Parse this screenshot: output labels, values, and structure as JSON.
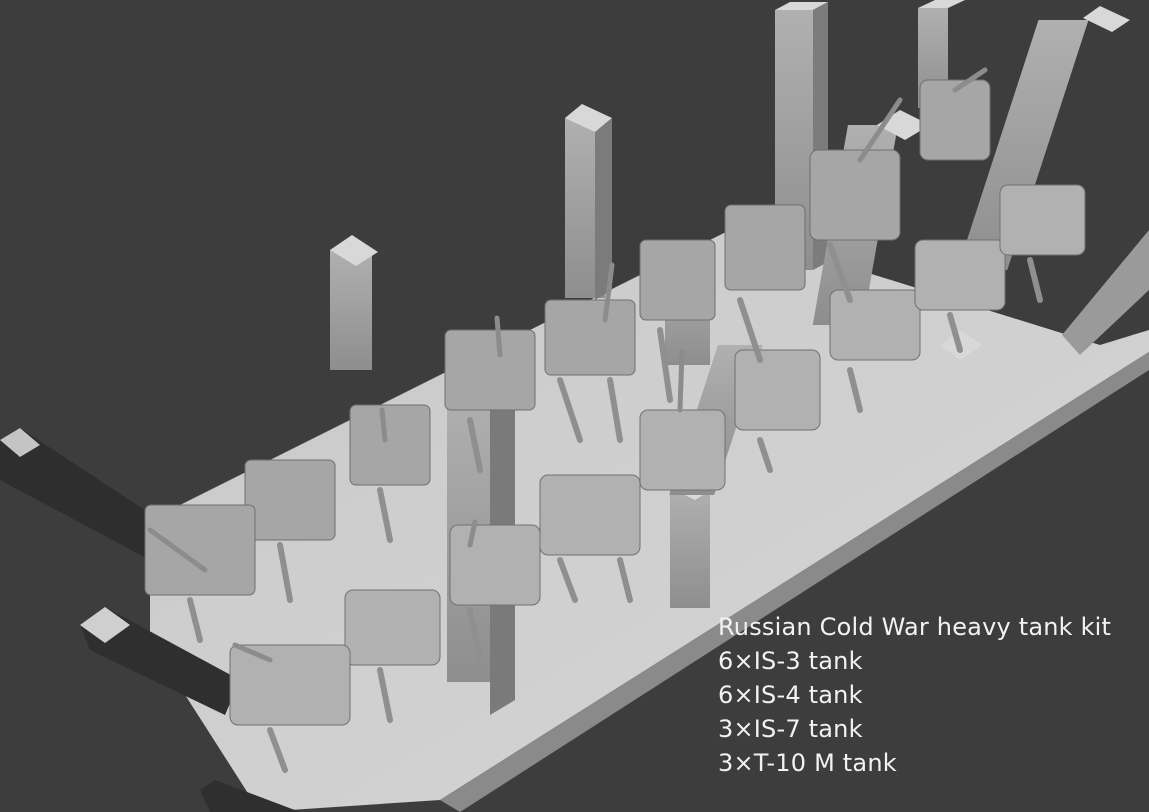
{
  "scene": {
    "subject": "3D render of a resin print plate with sprues and supports",
    "background_color": "#3d3d3d",
    "plate_color": "#cfcfcf",
    "model_color": "#a9a9a9"
  },
  "caption": {
    "title": "Russian Cold War heavy tank kit",
    "lines": [
      "6×IS-3 tank",
      "6×IS-4 tank",
      "3×IS-7 tank",
      "3×T-10 M tank"
    ]
  }
}
